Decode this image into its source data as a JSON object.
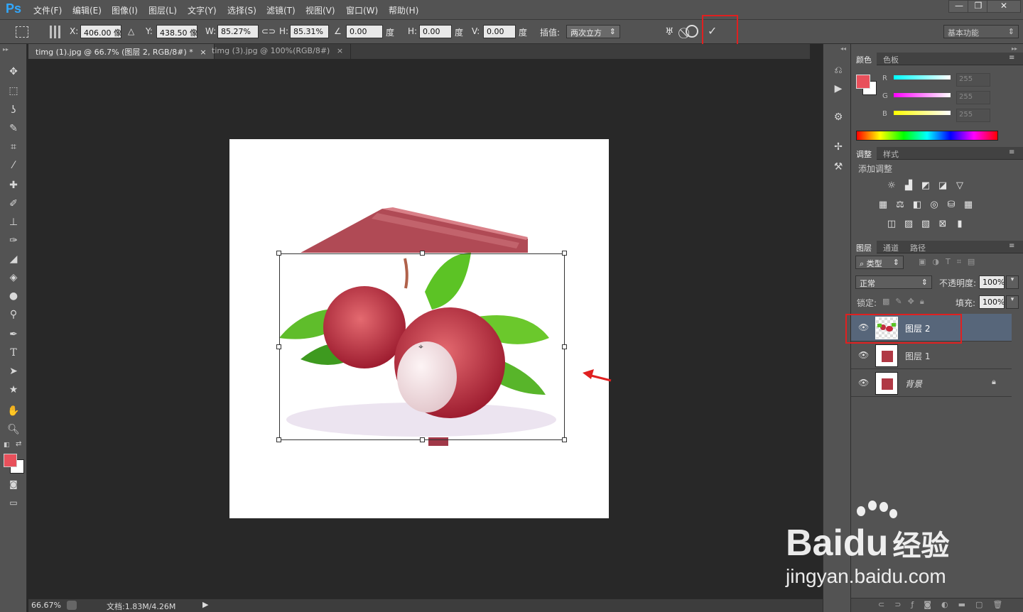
{
  "app": {
    "logo": "Ps"
  },
  "menu": [
    "文件(F)",
    "编辑(E)",
    "图像(I)",
    "图层(L)",
    "文字(Y)",
    "选择(S)",
    "滤镜(T)",
    "视图(V)",
    "窗口(W)",
    "帮助(H)"
  ],
  "window_buttons": [
    "—",
    "❐",
    "✕"
  ],
  "options": {
    "x_label": "X:",
    "x_value": "406.00 像",
    "y_label": "Y:",
    "y_value": "438.50 像",
    "w_label": "W:",
    "w_value": "85.27%",
    "h_label": "H:",
    "h_value": "85.31%",
    "angle_value": "0.00",
    "angle_unit": "度",
    "hskew_label": "H:",
    "hskew_value": "0.00",
    "hskew_unit": "度",
    "vskew_label": "V:",
    "vskew_value": "0.00",
    "vskew_unit": "度",
    "interp_label": "插值:",
    "interp_value": "两次立方",
    "workspace": "基本功能"
  },
  "tabs": [
    {
      "label": "timg (1).jpg @ 66.7% (图层 2, RGB/8#) *",
      "close": "×"
    },
    {
      "label": "timg (3).jpg @ 100%(RGB/8#)",
      "close": "×"
    }
  ],
  "status": {
    "zoom": "66.67%",
    "doc": "文档:1.83M/4.26M"
  },
  "color_panel": {
    "tabs": [
      "颜色",
      "色板"
    ],
    "channels": [
      {
        "label": "R",
        "value": "255"
      },
      {
        "label": "G",
        "value": "255"
      },
      {
        "label": "B",
        "value": "255"
      }
    ],
    "fg_color": "#e8505b"
  },
  "adjust_panel": {
    "tabs": [
      "调整",
      "样式"
    ],
    "title": "添加调整"
  },
  "layers_panel": {
    "tabs": [
      "图层",
      "通道",
      "路径"
    ],
    "filter_kind": "类型",
    "blend_mode": "正常",
    "opacity_label": "不透明度:",
    "opacity_value": "100%",
    "lock_label": "锁定:",
    "fill_label": "填充:",
    "fill_value": "100%",
    "layers": [
      {
        "name": "图层 2",
        "selected": true
      },
      {
        "name": "图层 1",
        "selected": false
      },
      {
        "name": "背景",
        "selected": false
      }
    ]
  },
  "watermark": {
    "brand": "Bai",
    "brand2": "du",
    "cn": "经验",
    "url": "jingyan.baidu.com"
  }
}
